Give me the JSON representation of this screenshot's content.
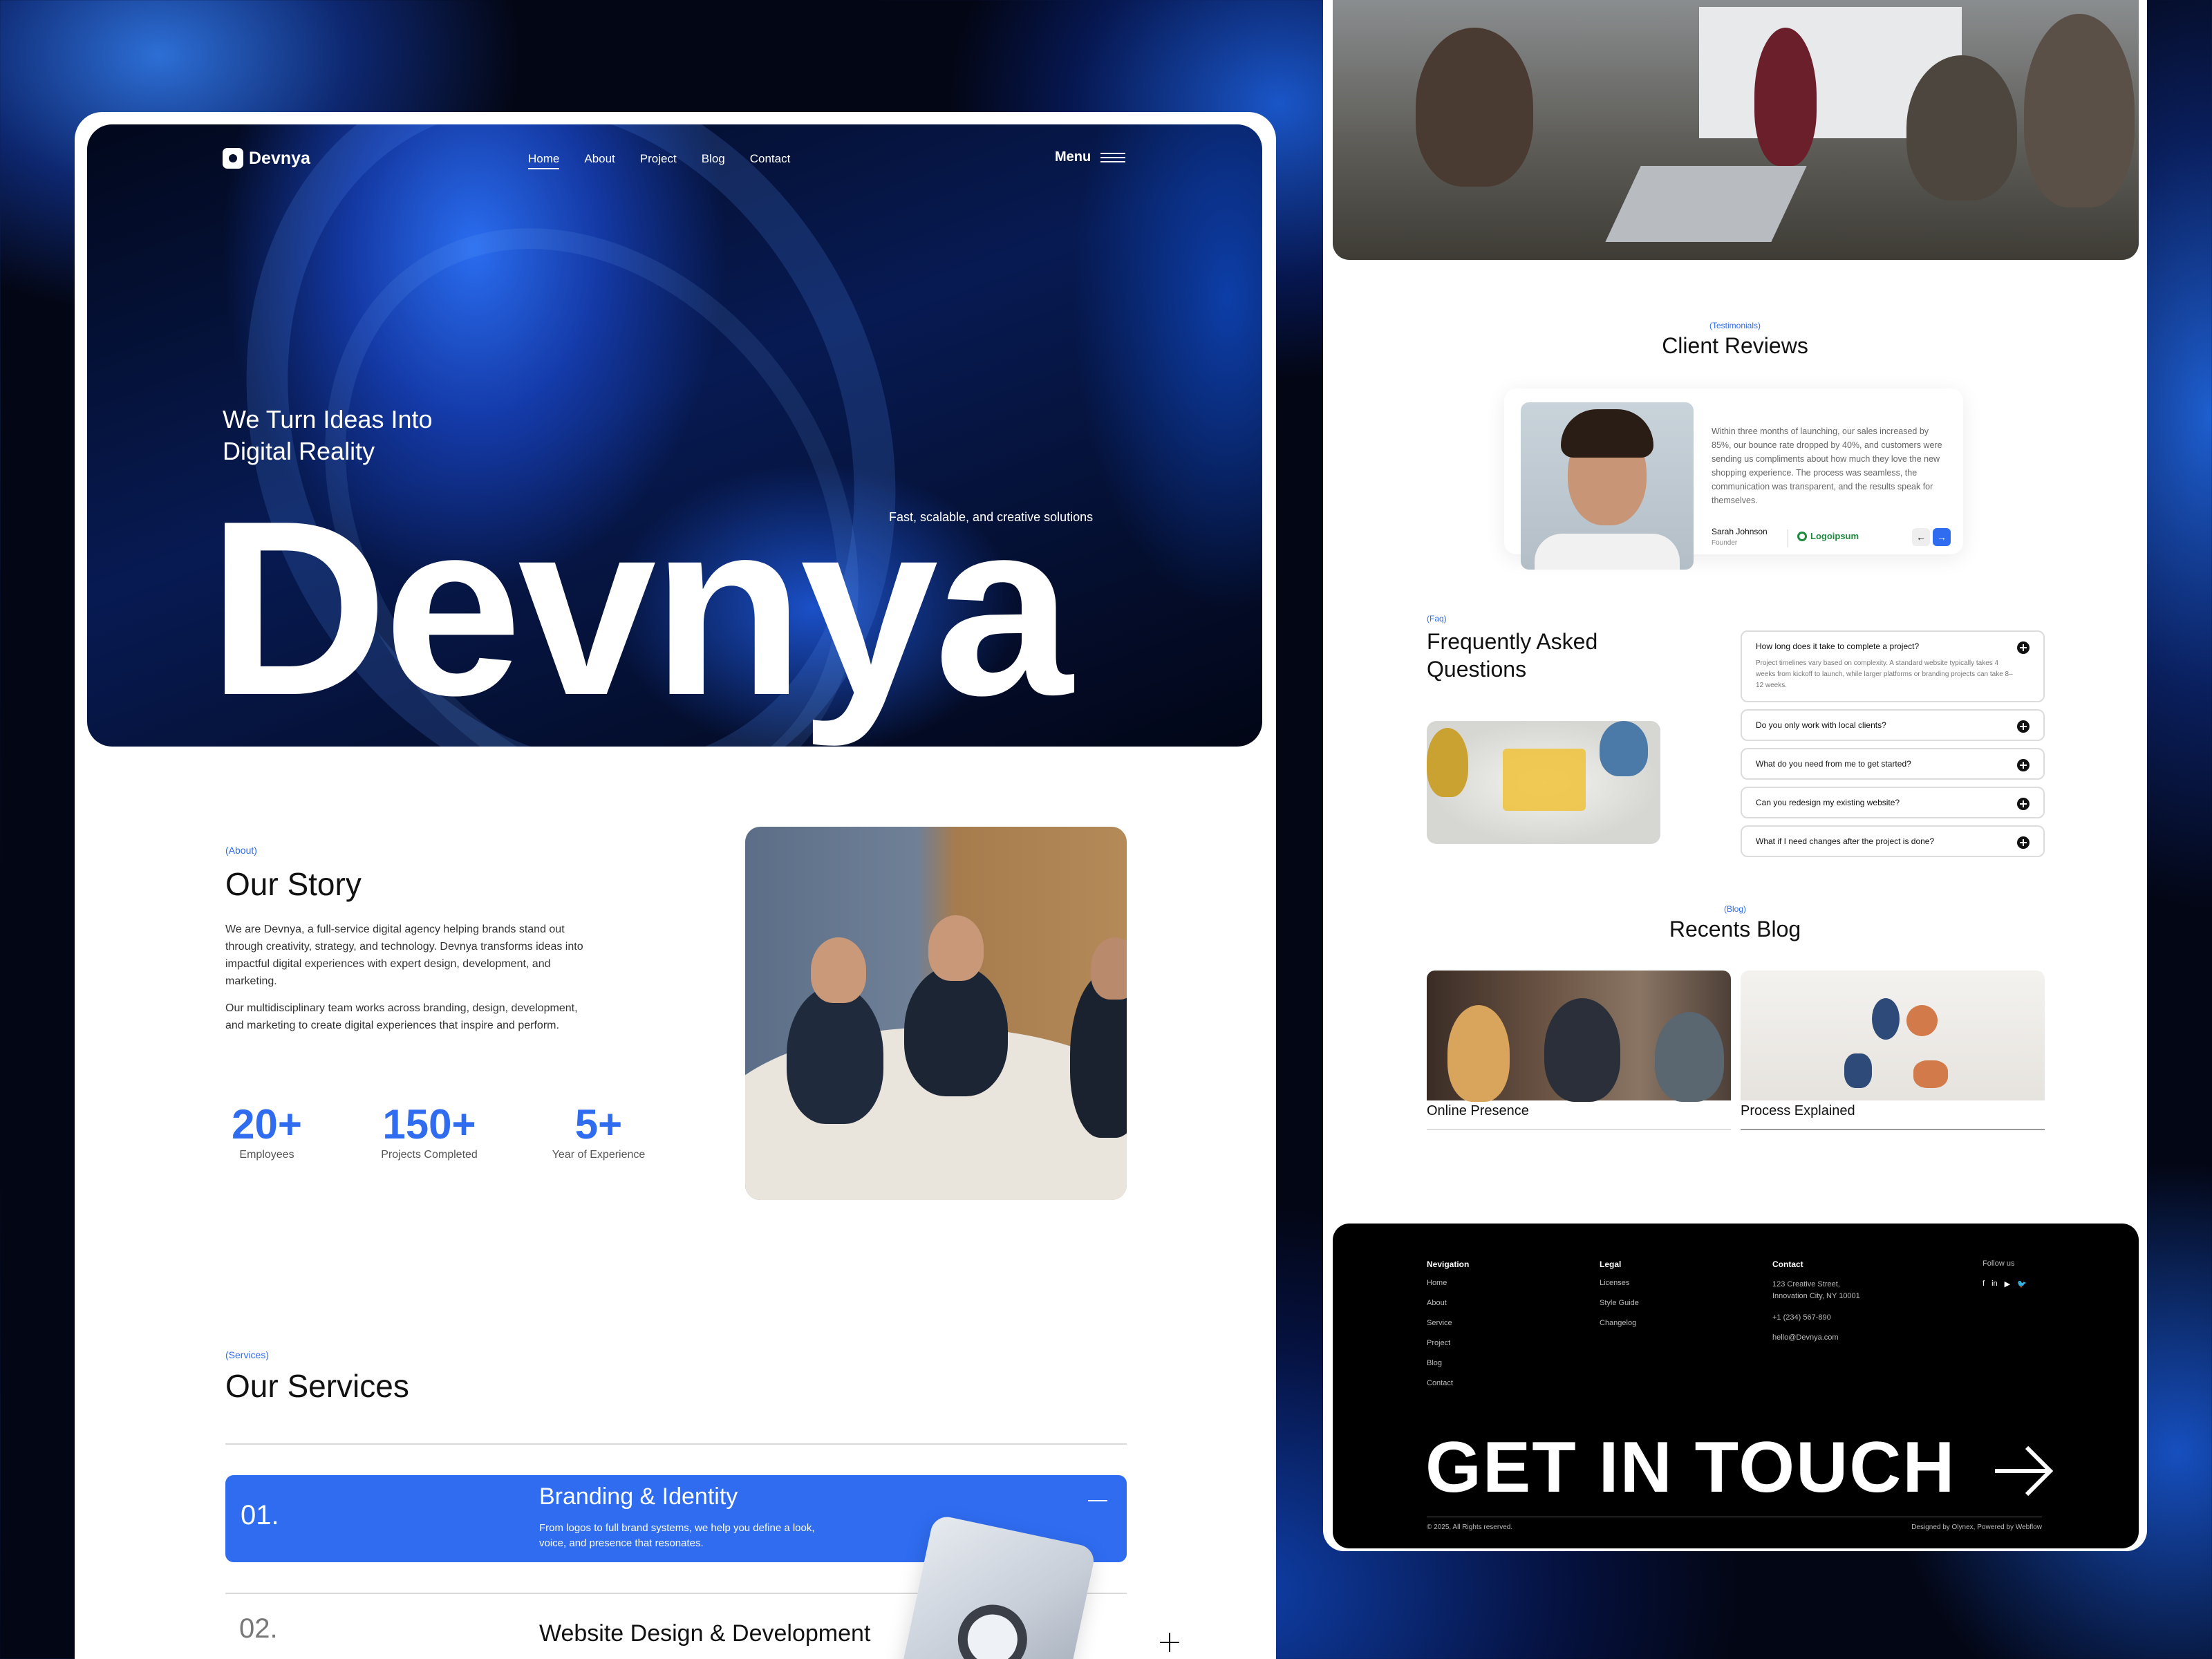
{
  "hero": {
    "brand": "Devnya",
    "nav": [
      "Home",
      "About",
      "Project",
      "Blog",
      "Contact"
    ],
    "menu_label": "Menu",
    "tagline": "We Turn Ideas Into Digital Reality",
    "subtagline": "Fast, scalable, and creative solutions",
    "big_word": "Devnya"
  },
  "story": {
    "tag": "(About)",
    "title": "Our Story",
    "p1": "We are Devnya, a full-service digital agency helping brands stand out through creativity, strategy, and technology. Devnya transforms ideas into impactful digital experiences with expert design, development, and marketing.",
    "p2": "Our multidisciplinary team works across branding, design, development, and marketing to create digital experiences that inspire and perform.",
    "stats": [
      {
        "value": "20+",
        "label": "Employees"
      },
      {
        "value": "150+",
        "label": "Projects Completed"
      },
      {
        "value": "5+",
        "label": "Year of Experience"
      }
    ]
  },
  "services": {
    "tag": "(Services)",
    "title": "Our Services",
    "items": [
      {
        "num": "01.",
        "title": "Branding & Identity",
        "desc": "From logos to full brand systems, we help you  define a look, voice, and presence that resonates."
      },
      {
        "num": "02.",
        "title": "Website Design & Development"
      }
    ]
  },
  "reviews": {
    "tag": "(Testimonials)",
    "title": "Client Reviews",
    "text": "Within three months of launching, our sales increased by 85%, our bounce rate dropped by 40%, and customers were sending us compliments about how much they love the new shopping experience. The process was seamless, the communication was transparent, and the results speak for themselves.",
    "name": "Sarah Johnson",
    "role": "Founder",
    "logo": "Logoipsum",
    "prev": "←",
    "next": "→"
  },
  "faq": {
    "tag": "(Faq)",
    "title": "Frequently Asked Questions",
    "items": [
      {
        "q": "How long does it take to complete a project?",
        "a": "Project timelines vary based on complexity. A standard website typically takes 4 weeks from kickoff to launch, while larger platforms or branding projects can take 8–12 weeks."
      },
      {
        "q": "Do you only work with local clients?"
      },
      {
        "q": "What do you need from me to get started?"
      },
      {
        "q": "Can you redesign my existing website?"
      },
      {
        "q": "What if I need changes after the project is done?"
      }
    ]
  },
  "blog": {
    "tag": "(Blog)",
    "title": "Recents Blog",
    "posts": [
      "Online Presence",
      "Process Explained"
    ]
  },
  "footer": {
    "nav_head": "Nevigation",
    "nav_links": [
      "Home",
      "About",
      "Service",
      "Project",
      "Blog",
      "Contact"
    ],
    "legal_head": "Legal",
    "legal_links": [
      "Licenses",
      "Style Guide",
      "Changelog"
    ],
    "contact_head": "Contact",
    "address": "123 Creative Street, Innovation City, NY 10001",
    "phone": "+1 (234) 567-890",
    "email": "hello@Devnya.com",
    "follow_head": "Follow us",
    "social": [
      "f",
      "in",
      "▶",
      "🐦"
    ],
    "cta": "GET IN TOUCH",
    "copyright": "© 2025, All Rights reserved.",
    "credit": "Designed by Olynex, Powered by Webflow"
  }
}
